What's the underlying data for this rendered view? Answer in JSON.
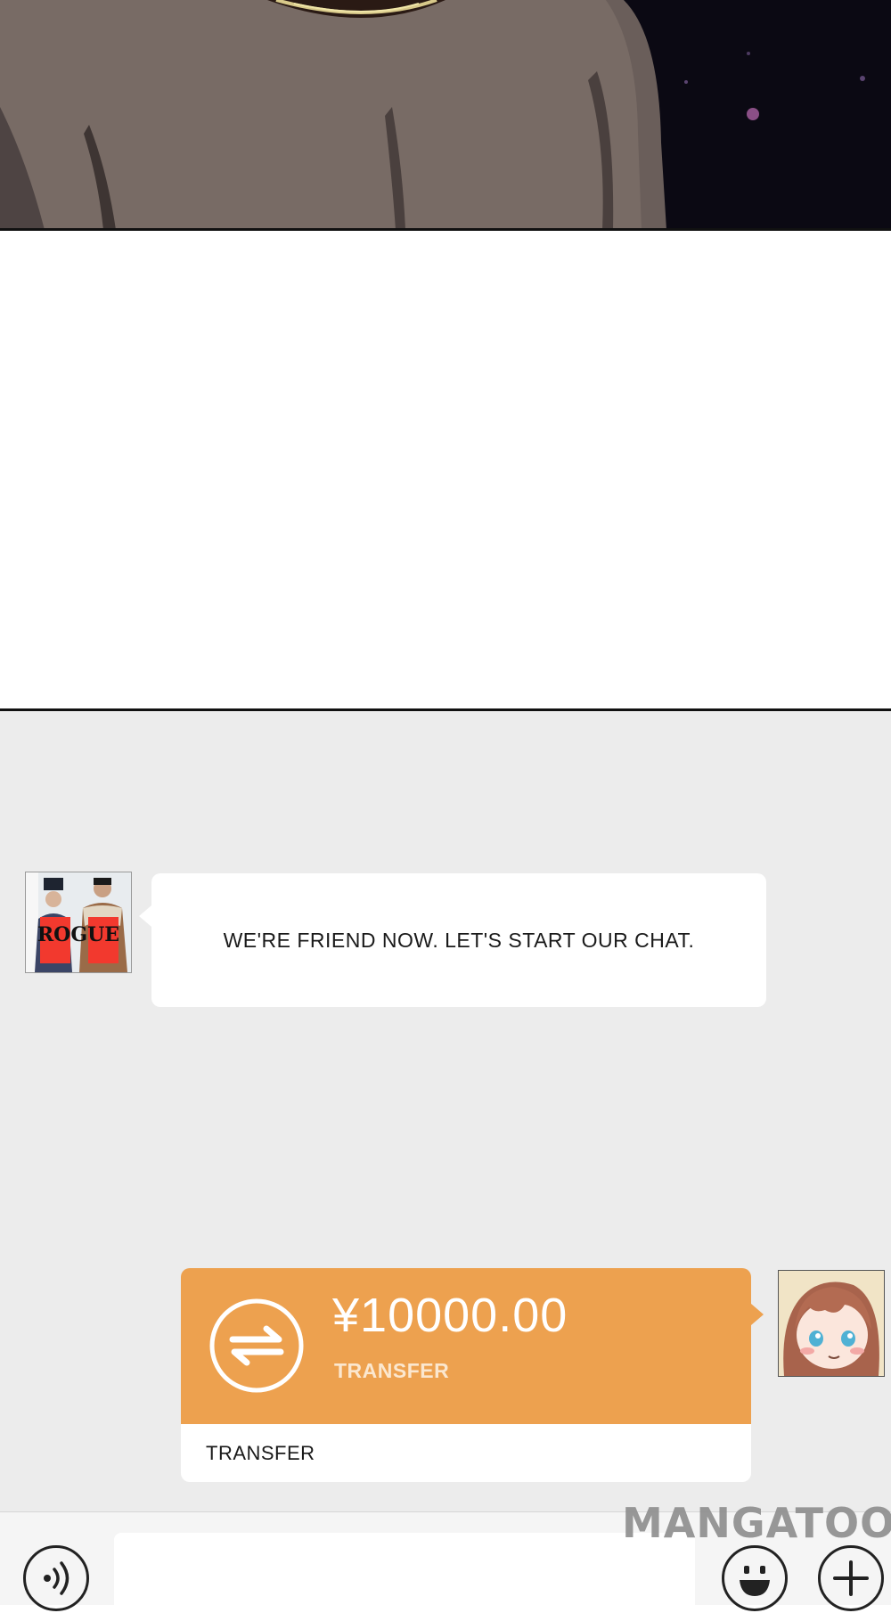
{
  "chat": {
    "friend_message": "WE'RE FRIEND NOW. LET'S START OUR CHAT.",
    "friend_avatar_sign": "ROGUE",
    "transfer": {
      "amount": "¥10000.00",
      "label": "TRANSFER",
      "footer_label": "TRANSFER"
    }
  },
  "input_bar": {
    "message_value": ""
  },
  "watermark": {
    "text": "MANGATOON"
  },
  "colors": {
    "transfer_orange": "#eda14f",
    "chat_background": "#ececec",
    "bubble_white": "#ffffff"
  },
  "icons": {
    "voice": "voice-icon",
    "emoji": "smiley-icon",
    "plus": "plus-icon",
    "transfer": "transfer-arrows-icon"
  }
}
